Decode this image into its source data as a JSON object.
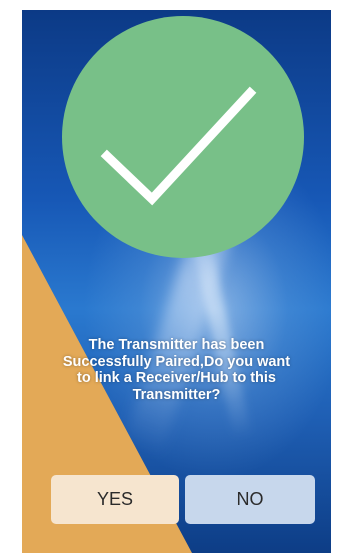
{
  "dialog": {
    "message": "The Transmitter has been\nSuccessfully Paired,Do you want\nto link a Receiver/Hub to this\nTransmitter?",
    "yes_label": "YES",
    "no_label": "NO"
  },
  "icons": {
    "status": "checkmark-icon"
  },
  "colors": {
    "check_circle": "#78c088",
    "accent_triangle": "#e3a957",
    "background": "#1758b6",
    "yes_button": "#f6e5cf",
    "no_button": "#c7d7ec"
  }
}
